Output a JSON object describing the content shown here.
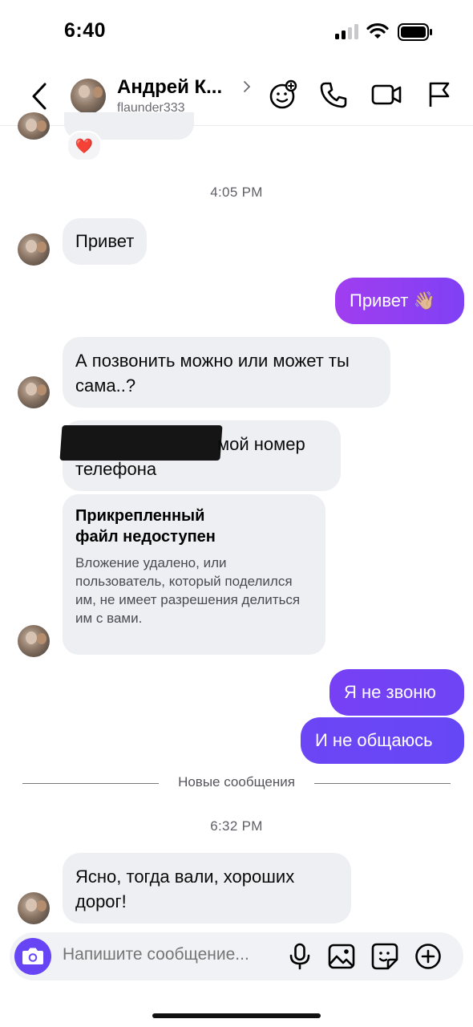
{
  "status_bar": {
    "time": "6:40"
  },
  "header": {
    "name": "Андрей К...",
    "username": "flaunder333"
  },
  "messages": {
    "reaction": "❤️",
    "timestamp_1": "4:05 PM",
    "in_1": "Привет",
    "out_1": "Привет 👋🏼",
    "in_2": "А позвонить можно или может ты сама..?",
    "in_3_suffix": "мой номер",
    "in_3_line2": "телефона",
    "attachment_title": "Прикрепленный файл недоступен",
    "attachment_desc": "Вложение удалено, или пользователь, который поделился им, не имеет разрешения делиться им с вами.",
    "out_2": "Я не звоню",
    "out_3": "И не общаюсь",
    "new_messages_label": "Новые сообщения",
    "timestamp_2": "6:32 PM",
    "in_4": "Ясно, тогда вали, хороших дорог!"
  },
  "composer": {
    "placeholder": "Напишите сообщение..."
  },
  "colors": {
    "accent": "#6745f5",
    "out_gradient_start": "#9b3cf0",
    "out_gradient_end": "#6a4af6",
    "incoming_bubble": "#eeeff3"
  }
}
